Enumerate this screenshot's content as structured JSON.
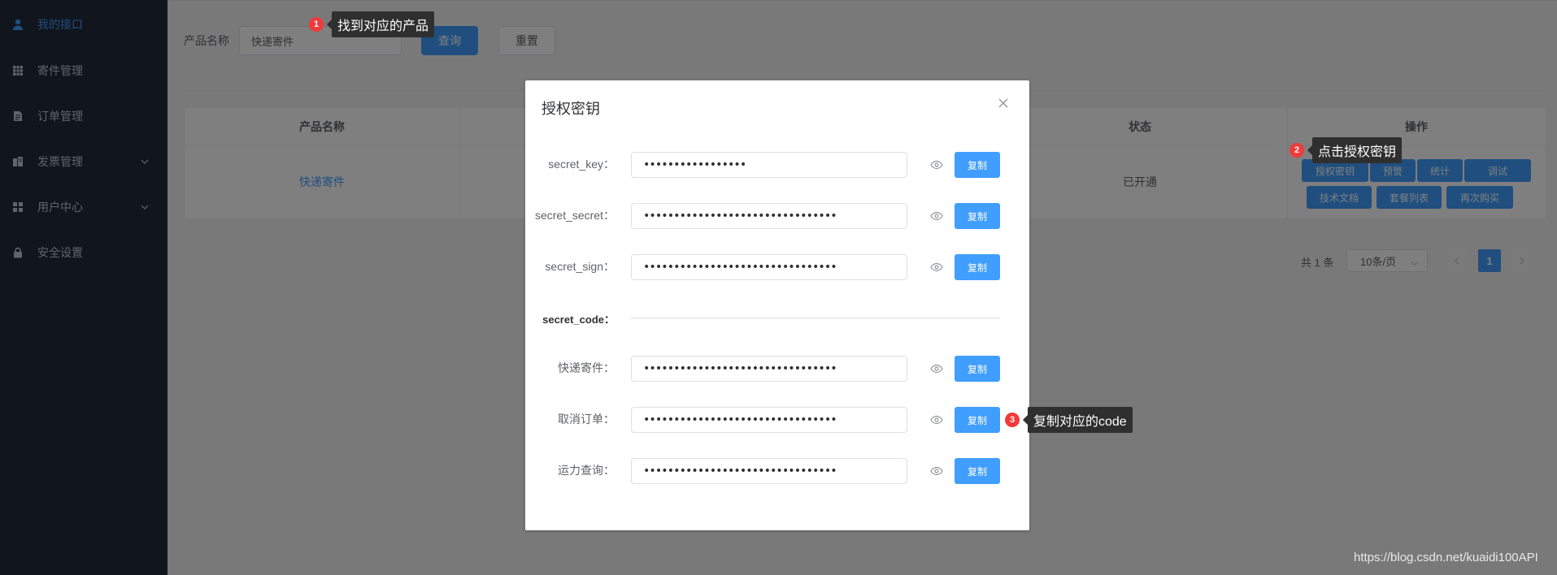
{
  "sidebar": {
    "items": [
      {
        "label": "我的接口",
        "icon": "user-icon",
        "active": true
      },
      {
        "label": "寄件管理",
        "icon": "grid-icon"
      },
      {
        "label": "订单管理",
        "icon": "document-icon"
      },
      {
        "label": "发票管理",
        "icon": "invoice-icon",
        "expandable": true
      },
      {
        "label": "用户中心",
        "icon": "apps-icon",
        "expandable": true
      },
      {
        "label": "安全设置",
        "icon": "lock-icon"
      }
    ]
  },
  "filter": {
    "product_label": "产品名称",
    "product_value": "快递寄件",
    "search_label": "查询",
    "reset_label": "重置"
  },
  "table": {
    "headers": {
      "product": "产品名称",
      "status": "状态",
      "actions": "操作"
    },
    "row": {
      "product": "快递寄件",
      "status": "已开通",
      "actions": [
        "授权密钥",
        "预警",
        "统计",
        "调试",
        "技术文档",
        "套餐列表",
        "再次购买"
      ]
    }
  },
  "pagination": {
    "total": "共 1 条",
    "page_size": "10条/页",
    "current_page": "1"
  },
  "dialog": {
    "title": "授权密钥",
    "copy_label": "复制",
    "fields": [
      {
        "label": "secret_key：",
        "masked": "•••••••••••••••••"
      },
      {
        "label": "secret_secret：",
        "masked": "••••••••••••••••••••••••••••••••"
      },
      {
        "label": "secret_sign：",
        "masked": "••••••••••••••••••••••••••••••••"
      }
    ],
    "code_section_label": "secret_code：",
    "codes": [
      {
        "label": "快递寄件：",
        "masked": "••••••••••••••••••••••••••••••••"
      },
      {
        "label": "取消订单：",
        "masked": "••••••••••••••••••••••••••••••••"
      },
      {
        "label": "运力查询：",
        "masked": "••••••••••••••••••••••••••••••••"
      }
    ]
  },
  "annotations": [
    {
      "num": "1",
      "text": "找到对应的产品"
    },
    {
      "num": "2",
      "text": "点击授权密钥"
    },
    {
      "num": "3",
      "text": "复制对应的code"
    }
  ],
  "watermark": "https://blog.csdn.net/kuaidi100API",
  "colors": {
    "sidebar_bg": "#222b3c",
    "accent": "#409eff",
    "annotation_dot": "#f13a3a",
    "annotation_box": "#2f2f2f"
  }
}
